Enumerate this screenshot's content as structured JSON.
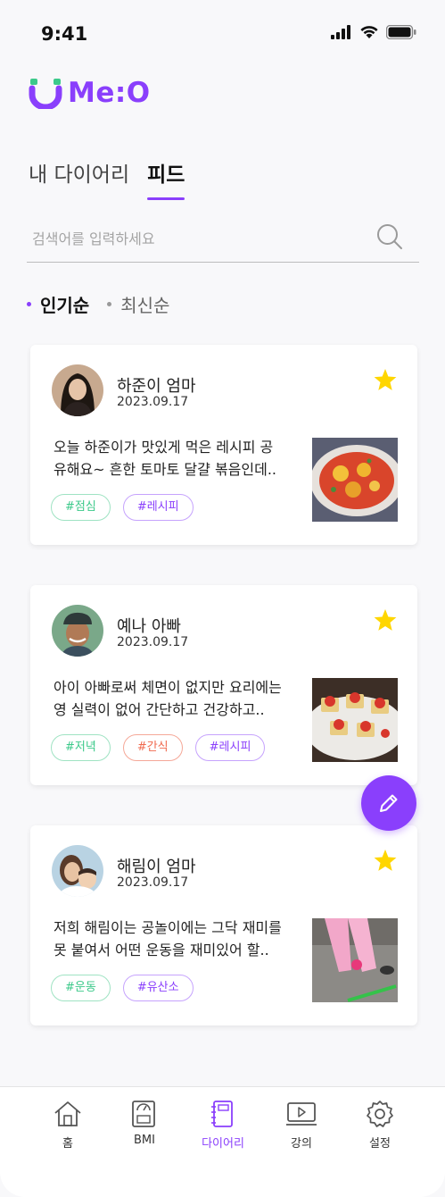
{
  "status_bar": {
    "time": "9:41"
  },
  "logo": {
    "text": "Me:O",
    "brand_color": "#8a3ffc"
  },
  "tabs": [
    {
      "label": "내 다이어리",
      "active": false
    },
    {
      "label": "피드",
      "active": true
    }
  ],
  "search": {
    "placeholder": "검색어를 입력하세요",
    "value": ""
  },
  "sort": [
    {
      "label": "인기순",
      "active": true
    },
    {
      "label": "최신순",
      "active": false
    }
  ],
  "posts": [
    {
      "author": "하준이 엄마",
      "date": "2023.09.17",
      "body_line1": "오늘 하준이가 맛있게 먹은 레시피 공",
      "body_line2": "유해요~ 흔한 토마토 달걀 볶음인데..",
      "tags": [
        {
          "label": "#점심",
          "color": "#3cc98a"
        },
        {
          "label": "#레시피",
          "color": "#8a3ffc"
        }
      ]
    },
    {
      "author": "예나 아빠",
      "date": "2023.09.17",
      "body_line1": "아이 아빠로써 체면이 없지만 요리에는",
      "body_line2": "영 실력이 없어 간단하고 건강하고..",
      "tags": [
        {
          "label": "#저녁",
          "color": "#3cc98a"
        },
        {
          "label": "#간식",
          "color": "#f06a4f"
        },
        {
          "label": "#레시피",
          "color": "#8a3ffc"
        }
      ]
    },
    {
      "author": "해림이 엄마",
      "date": "2023.09.17",
      "body_line1": "저희 해림이는 공놀이에는 그닥 재미를",
      "body_line2": "못 붙여서 어떤 운동을 재미있어 할..",
      "tags": [
        {
          "label": "#운동",
          "color": "#3cc98a"
        },
        {
          "label": "#유산소",
          "color": "#8a3ffc"
        }
      ]
    }
  ],
  "bottom_nav": [
    {
      "label": "홈",
      "icon": "home-icon",
      "active": false
    },
    {
      "label": "BMI",
      "icon": "bmi-icon",
      "active": false
    },
    {
      "label": "다이어리",
      "icon": "diary-icon",
      "active": true
    },
    {
      "label": "강의",
      "icon": "lecture-icon",
      "active": false
    },
    {
      "label": "설정",
      "icon": "settings-icon",
      "active": false
    }
  ],
  "colors": {
    "accent": "#8a3ffc",
    "star": "#ffd600",
    "green": "#3cc98a",
    "red": "#f06a4f"
  }
}
